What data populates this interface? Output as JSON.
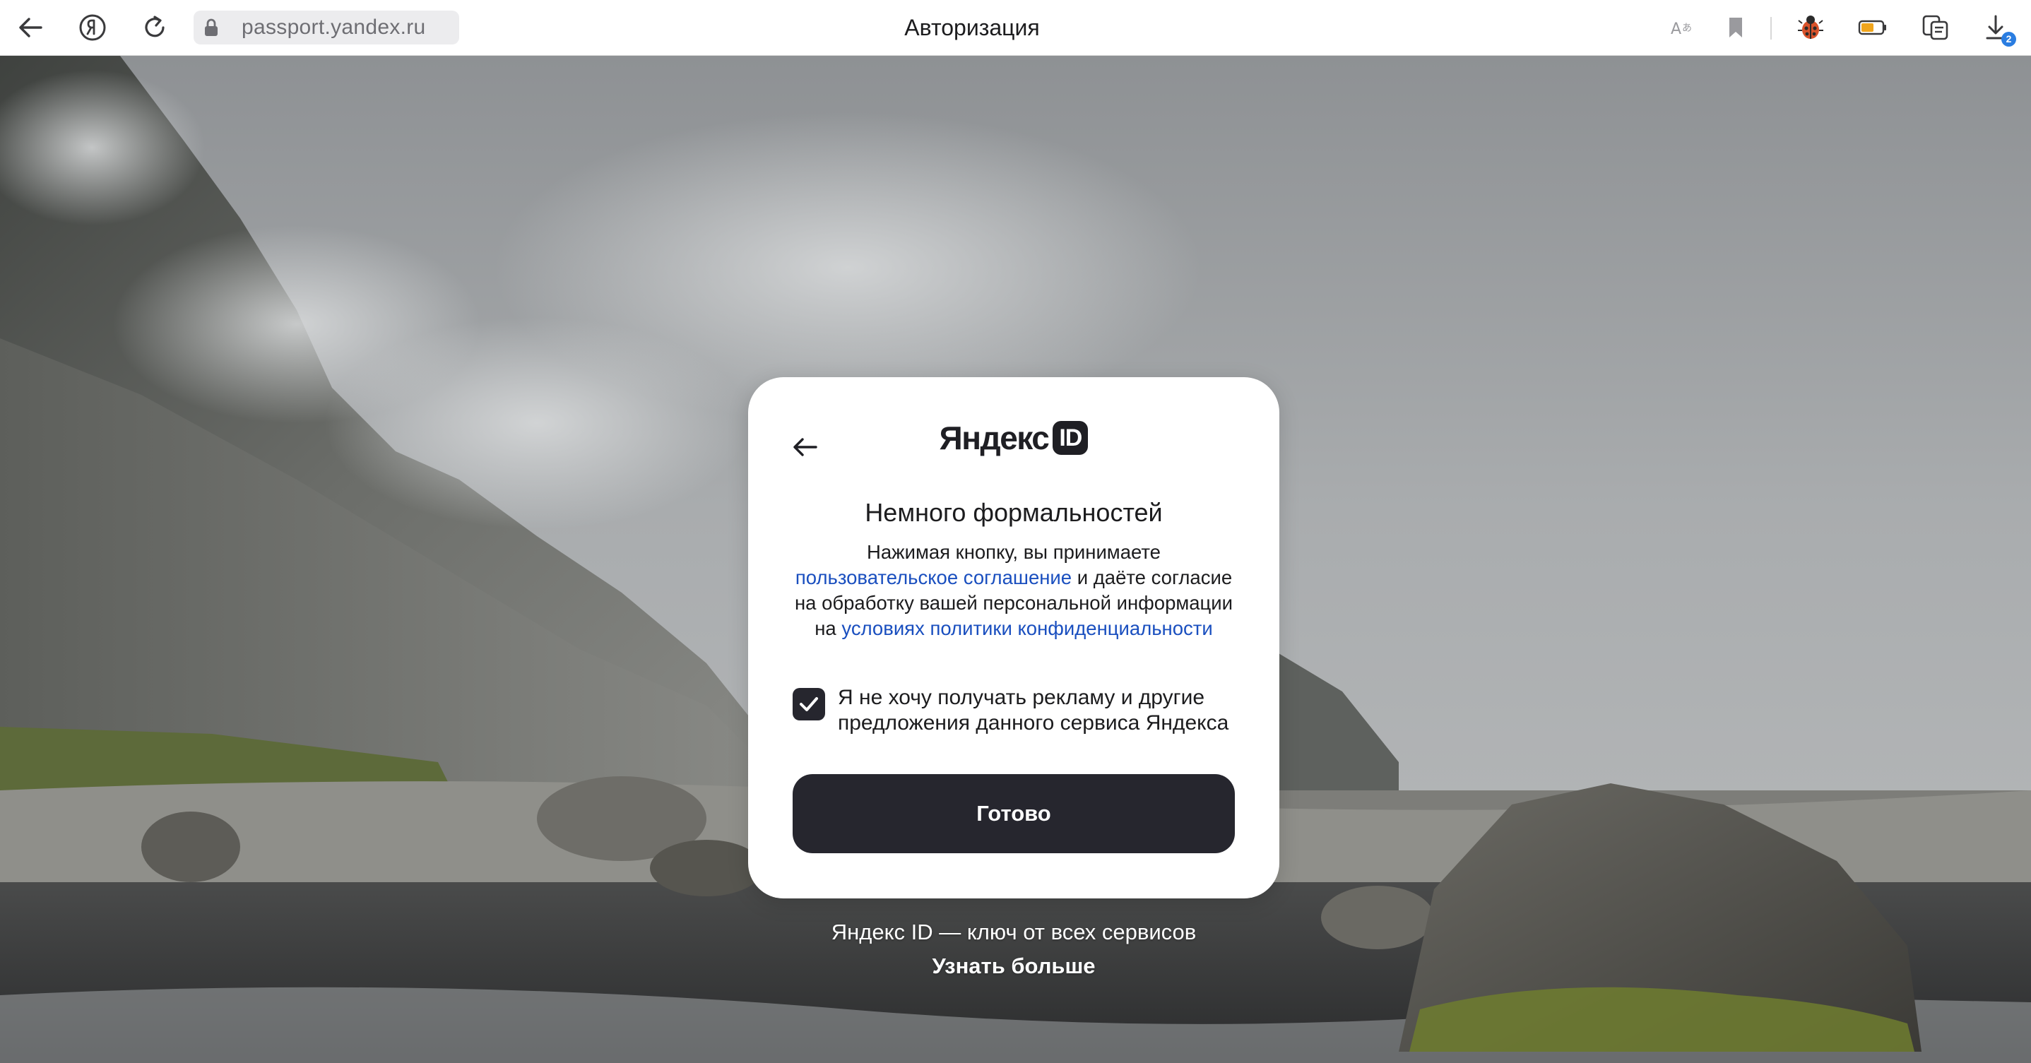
{
  "browser": {
    "url": "passport.yandex.ru",
    "title": "Авторизация",
    "downloads_count": "2",
    "icons": {
      "back": "back-arrow-icon",
      "yandex": "yandex-logo-icon",
      "reload": "reload-icon",
      "lock": "lock-icon",
      "translate": "translate-icon",
      "bookmark": "bookmark-icon",
      "bug": "ladybug-extension-icon",
      "battery": "battery-icon",
      "reader": "reader-mode-icon",
      "downloads": "download-icon"
    }
  },
  "dialog": {
    "brand": "Яндекс",
    "brand_badge": "ID",
    "heading": "Немного формальностей",
    "legal": {
      "part1": "Нажимая кнопку, вы принимаете ",
      "link1": "пользовательское соглашение",
      "part2": " и даёте согласие на обработку вашей персональной информации на ",
      "link2": "условиях политики конфиденциальности"
    },
    "consent_checked": true,
    "consent_label": "Я не хочу получать рекламу и другие предложения данного сервиса Яндекса",
    "done_button": "Готово"
  },
  "footer": {
    "tagline": "Яндекс ID — ключ от всех сервисов",
    "learn_more": "Узнать больше"
  },
  "colors": {
    "accent_dark": "#26262e",
    "link_blue": "#1a4fbf",
    "badge_blue": "#2a7de1"
  }
}
